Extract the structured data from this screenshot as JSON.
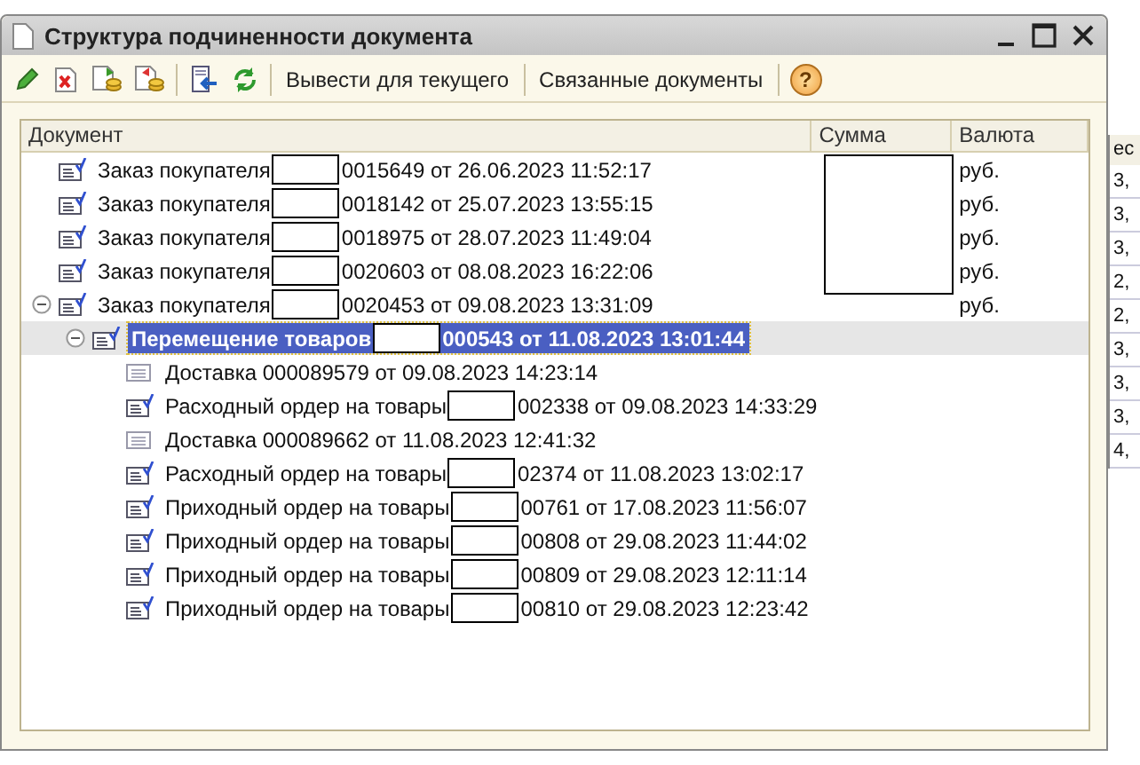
{
  "background": {
    "column_header": "ес",
    "column_cells": [
      "3,",
      "3,",
      "3,",
      "2,",
      "2,",
      "3,",
      "3,",
      "3,",
      "4,"
    ]
  },
  "window": {
    "title": "Структура подчиненности документа"
  },
  "toolbar": {
    "buttons": [
      "Вывести для текущего",
      "Связанные документы"
    ],
    "help": "?"
  },
  "table": {
    "columns": [
      "Документ",
      "Сумма",
      "Валюта"
    ],
    "rows": [
      {
        "kind": "posted",
        "parts": [
          "Заказ покупателя",
          "0015649 от 26.06.2023 11:52:17"
        ],
        "currency": "руб.",
        "selected": false
      },
      {
        "kind": "posted",
        "parts": [
          "Заказ покупателя",
          "0018142 от 25.07.2023 13:55:15"
        ],
        "currency": "руб.",
        "selected": false
      },
      {
        "kind": "posted",
        "parts": [
          "Заказ покупателя",
          "0018975 от 28.07.2023 11:49:04"
        ],
        "currency": "руб.",
        "selected": false
      },
      {
        "kind": "posted",
        "parts": [
          "Заказ покупателя",
          "0020603 от 08.08.2023 16:22:06"
        ],
        "currency": "руб.",
        "selected": false
      },
      {
        "kind": "posted",
        "parts": [
          "Заказ покупателя",
          "0020453 от 09.08.2023 13:31:09"
        ],
        "currency": "руб.",
        "selected": false,
        "expanded": true,
        "children": [
          {
            "kind": "posted",
            "parts": [
              "Перемещение товаров",
              "000543 от 11.08.2023 13:01:44"
            ],
            "selected": true,
            "expanded": true,
            "children": [
              {
                "kind": "plain",
                "parts": [
                  "Доставка 000089579 от 09.08.2023 14:23:14"
                ],
                "selected": false
              },
              {
                "kind": "posted",
                "parts": [
                  "Расходный ордер на товары",
                  "002338 от 09.08.2023 14:33:29"
                ],
                "selected": false
              },
              {
                "kind": "plain",
                "parts": [
                  "Доставка 000089662 от 11.08.2023 12:41:32"
                ],
                "selected": false
              },
              {
                "kind": "posted",
                "parts": [
                  "Расходный ордер на товары",
                  "02374 от 11.08.2023 13:02:17"
                ],
                "selected": false
              },
              {
                "kind": "posted",
                "parts": [
                  "Приходный ордер на товары",
                  "00761 от 17.08.2023 11:56:07"
                ],
                "selected": false
              },
              {
                "kind": "posted",
                "parts": [
                  "Приходный ордер на товары",
                  "00808 от 29.08.2023 11:44:02"
                ],
                "selected": false
              },
              {
                "kind": "posted",
                "parts": [
                  "Приходный ордер на товары",
                  "00809 от 29.08.2023 12:11:14"
                ],
                "selected": false
              },
              {
                "kind": "posted",
                "parts": [
                  "Приходный ордер на товары",
                  "00810 от 29.08.2023 12:23:42"
                ],
                "selected": false
              }
            ]
          }
        ]
      }
    ]
  }
}
